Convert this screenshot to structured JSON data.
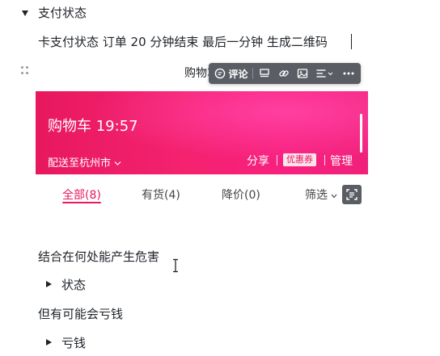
{
  "doc": {
    "heading": "支付状态",
    "line1": "卡支付状态  订单 20 分钟结束  最后一分钟  生成二维码",
    "image_caption_partial": "购物车",
    "para1": "结合在何处能产生危害",
    "bullet1": "状态",
    "para2": "但有可能会亏钱",
    "bullet2": "亏钱"
  },
  "toolbar": {
    "comment_label": "评论",
    "items": [
      "comment-icon",
      "caption-icon",
      "link-icon",
      "image-icon",
      "align-icon",
      "more-icon"
    ]
  },
  "cart_image": {
    "title": "购物车 19:57",
    "deliver": "配送至杭州市",
    "share": "分享",
    "coupon": "优惠券",
    "manage": "管理",
    "tabs": [
      {
        "label": "全部(8)",
        "active": true
      },
      {
        "label": "有货(4)",
        "active": false
      },
      {
        "label": "降价(0)",
        "active": false
      }
    ],
    "filter": "筛选",
    "accent": "#e8185f"
  }
}
